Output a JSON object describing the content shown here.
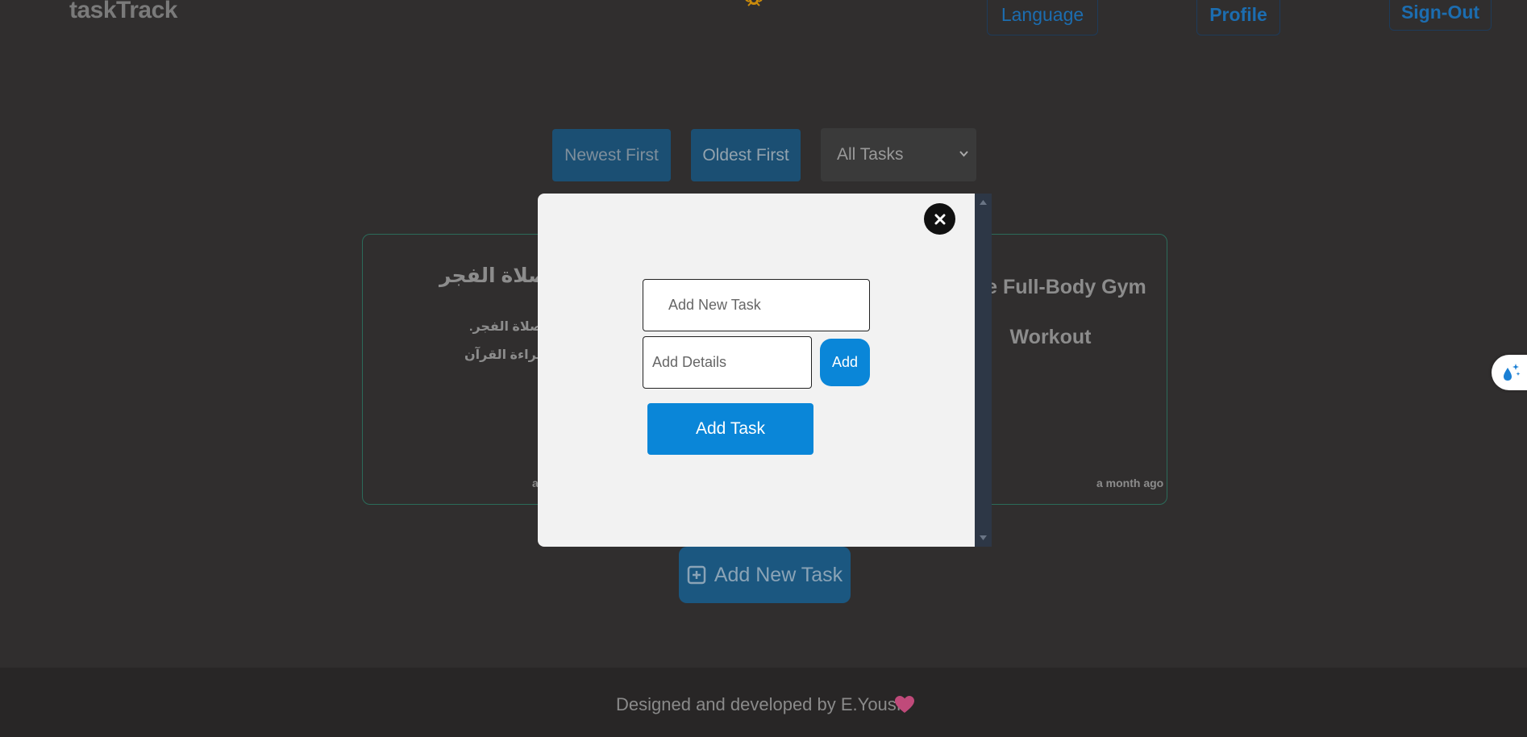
{
  "header": {
    "brand": "taskTrack",
    "nav": {
      "language": "Language",
      "profile": "Profile",
      "sign_out": "Sign-Out"
    }
  },
  "sort": {
    "newest": "Newest First",
    "oldest": "Oldest First",
    "filter_selected": "All Tasks"
  },
  "tasks": [
    {
      "title": "صلاة الفجر",
      "lines": [
        ": صلاة الفجر.",
        ": قراءة القرآن"
      ],
      "time": "a"
    },
    {
      "title_line1": "nute Full-Body Gym",
      "title_line2": "Workout",
      "time": "a month ago"
    }
  ],
  "add_new": {
    "label": "Add New Task"
  },
  "modal": {
    "task_placeholder": "Add New Task",
    "details_placeholder": "Add Details",
    "add_label": "Add",
    "add_task_label": "Add Task"
  },
  "footer": {
    "text": "Designed and developed by E.Yousfi"
  },
  "colors": {
    "accent": "#0a86d8",
    "card_border": "#2b6b5a",
    "heart": "#c04a7a"
  },
  "icons": [
    "sun-icon",
    "chevron-down-icon",
    "plus-square-icon",
    "close-icon",
    "heart-icon",
    "drop-sparkle-icon"
  ]
}
